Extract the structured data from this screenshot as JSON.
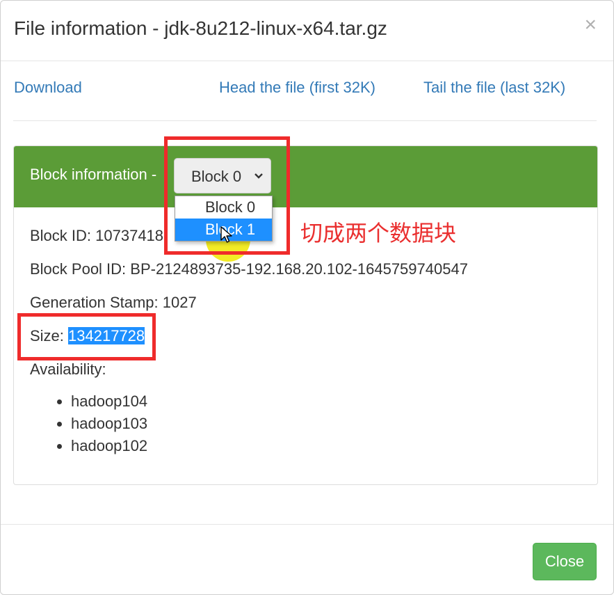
{
  "modal": {
    "title": "File information - jdk-8u212-linux-x64.tar.gz",
    "close_symbol": "×"
  },
  "links": {
    "download": "Download",
    "head": "Head the file (first 32K)",
    "tail": "Tail the file (last 32K)"
  },
  "block_panel": {
    "heading": "Block information -",
    "select": {
      "value": "Block 0",
      "options": [
        "Block 0",
        "Block 1"
      ],
      "highlighted": "Block 1"
    },
    "block_id_label": "Block ID: ",
    "block_id_value": "10737418",
    "block_pool_id": "Block Pool ID: BP-2124893735-192.168.20.102-1645759740547",
    "generation_stamp": "Generation Stamp: 1027",
    "size_label": "Size: ",
    "size_value": "134217728",
    "availability_label": "Availability:",
    "availability": [
      "hadoop104",
      "hadoop103",
      "hadoop102"
    ]
  },
  "annotation": {
    "text": "切成两个数据块",
    "color": "#ea2f2f"
  },
  "footer": {
    "close_label": "Close"
  },
  "colors": {
    "panel_header": "#5b9c37",
    "link": "#337ab7",
    "selection": "#1e90ff",
    "close_button": "#5cb85c"
  }
}
